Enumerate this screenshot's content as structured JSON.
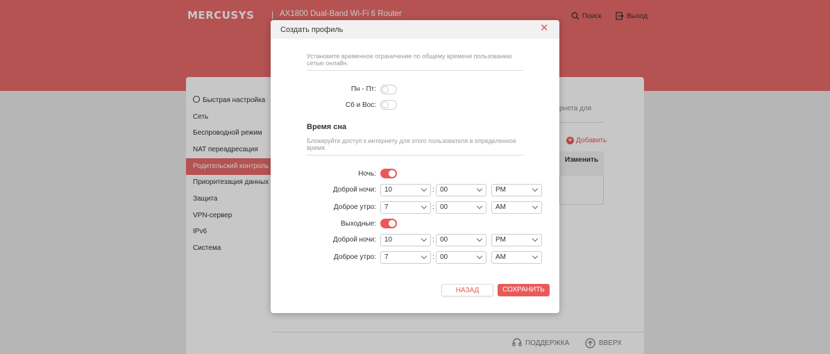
{
  "header": {
    "logo": "MERCUSYS",
    "separator": "|",
    "model": "AX1800 Dual-Band Wi-Fi 6 Router",
    "search_label": "Поиск",
    "logout_label": "Выход"
  },
  "sidebar": {
    "items": [
      {
        "label": "Быстрая настройка"
      },
      {
        "label": "Сеть"
      },
      {
        "label": "Беспроводной режим"
      },
      {
        "label": "NAT переадресация"
      },
      {
        "label": "Родительский контроль"
      },
      {
        "label": "Приоритезация данных"
      },
      {
        "label": "Защита"
      },
      {
        "label": "VPN-сервер"
      },
      {
        "label": "IPv6"
      },
      {
        "label": "Система"
      }
    ]
  },
  "content": {
    "partial_text": "рнета для",
    "add_label": "Добавить",
    "column_edit": "Изменить"
  },
  "footer": {
    "support_label": "ПОДДЕРЖКА",
    "top_label": "ВВЕРХ"
  },
  "modal": {
    "title": "Создать профиль",
    "time_limit_hint": "Установите временное ограничение по общему времени пользованию сетью онлайн.",
    "weekdays_label": "Пн - Пт:",
    "weekend_label": "Сб и Вос:",
    "sleep_title": "Время сна",
    "sleep_hint": "Блокируйте доступ к интернету для этого пользователя в определенное время.",
    "night_label": "Ночь:",
    "weekend_days_label": "Выходные:",
    "goodnight_label": "Доброй ночи:",
    "goodmorning_label": "Доброе утро:",
    "colon": ":",
    "night": {
      "goodnight": {
        "hour": "10",
        "minute": "00",
        "ampm": "PM"
      },
      "goodmorning": {
        "hour": "7",
        "minute": "00",
        "ampm": "AM"
      }
    },
    "weekend": {
      "goodnight": {
        "hour": "10",
        "minute": "00",
        "ampm": "PM"
      },
      "goodmorning": {
        "hour": "7",
        "minute": "00",
        "ampm": "AM"
      }
    },
    "back_label": "НАЗАД",
    "save_label": "СОХРАНИТЬ"
  },
  "colors": {
    "brand": "#e86a6a",
    "accent": "#e85a5a"
  }
}
